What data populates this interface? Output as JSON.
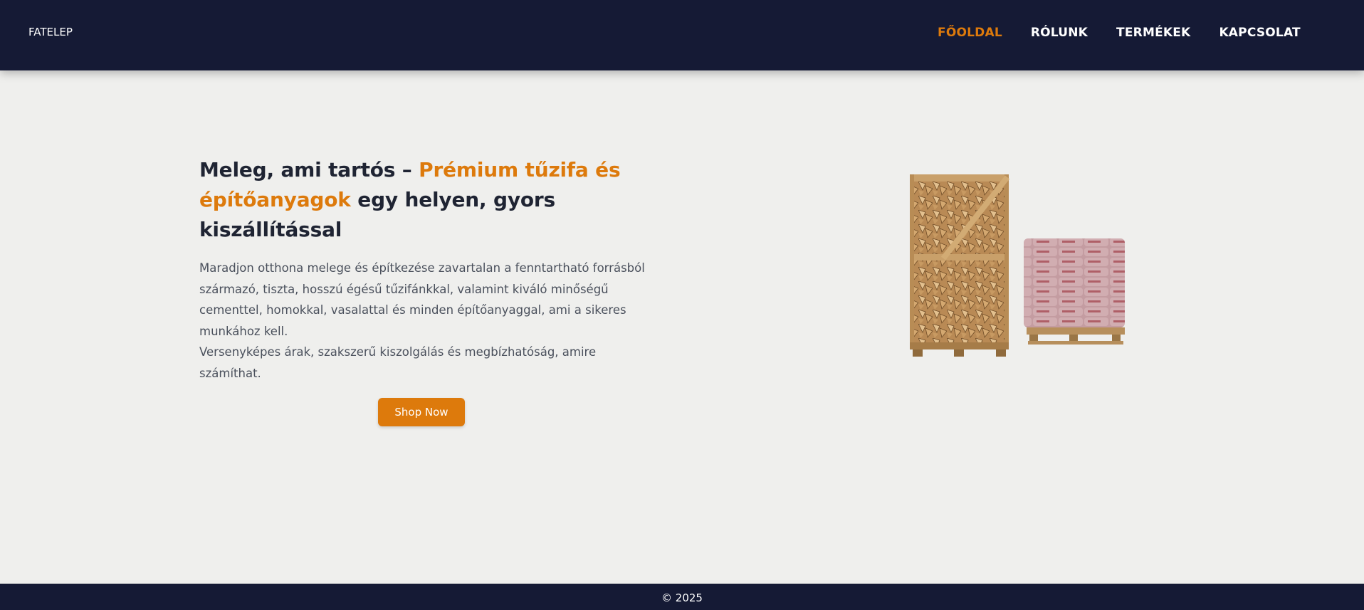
{
  "brand": "FATELEP",
  "nav": {
    "items": [
      {
        "label": "FŐOLDAL"
      },
      {
        "label": "RÓLUNK"
      },
      {
        "label": "TERMÉKEK"
      },
      {
        "label": "KAPCSOLAT"
      }
    ]
  },
  "hero": {
    "headline_part1": "Meleg, ami tartós – ",
    "headline_accent": "Prémium tűzifa és építőanyagok",
    "headline_part2": " egy helyen, gyors kiszállítással",
    "description_line1": "Maradjon otthona melege és építkezése zavartalan a fenntartható forrásból származó, tiszta, hosszú égésű tűzifánkkal, valamint kiváló minőségű cementtel, homokkal, vasalattal és minden építőanyaggal, ami a sikeres munkához kell.",
    "description_line2": "Versenyképes árak, szakszerű kiszolgálás és megbízhatóság, amire számíthat.",
    "cta_label": "Shop Now"
  },
  "footer": {
    "copyright": "© 2025"
  },
  "colors": {
    "navbar": "#151a35",
    "accent": "#dd7a0c",
    "background": "#efefed"
  }
}
